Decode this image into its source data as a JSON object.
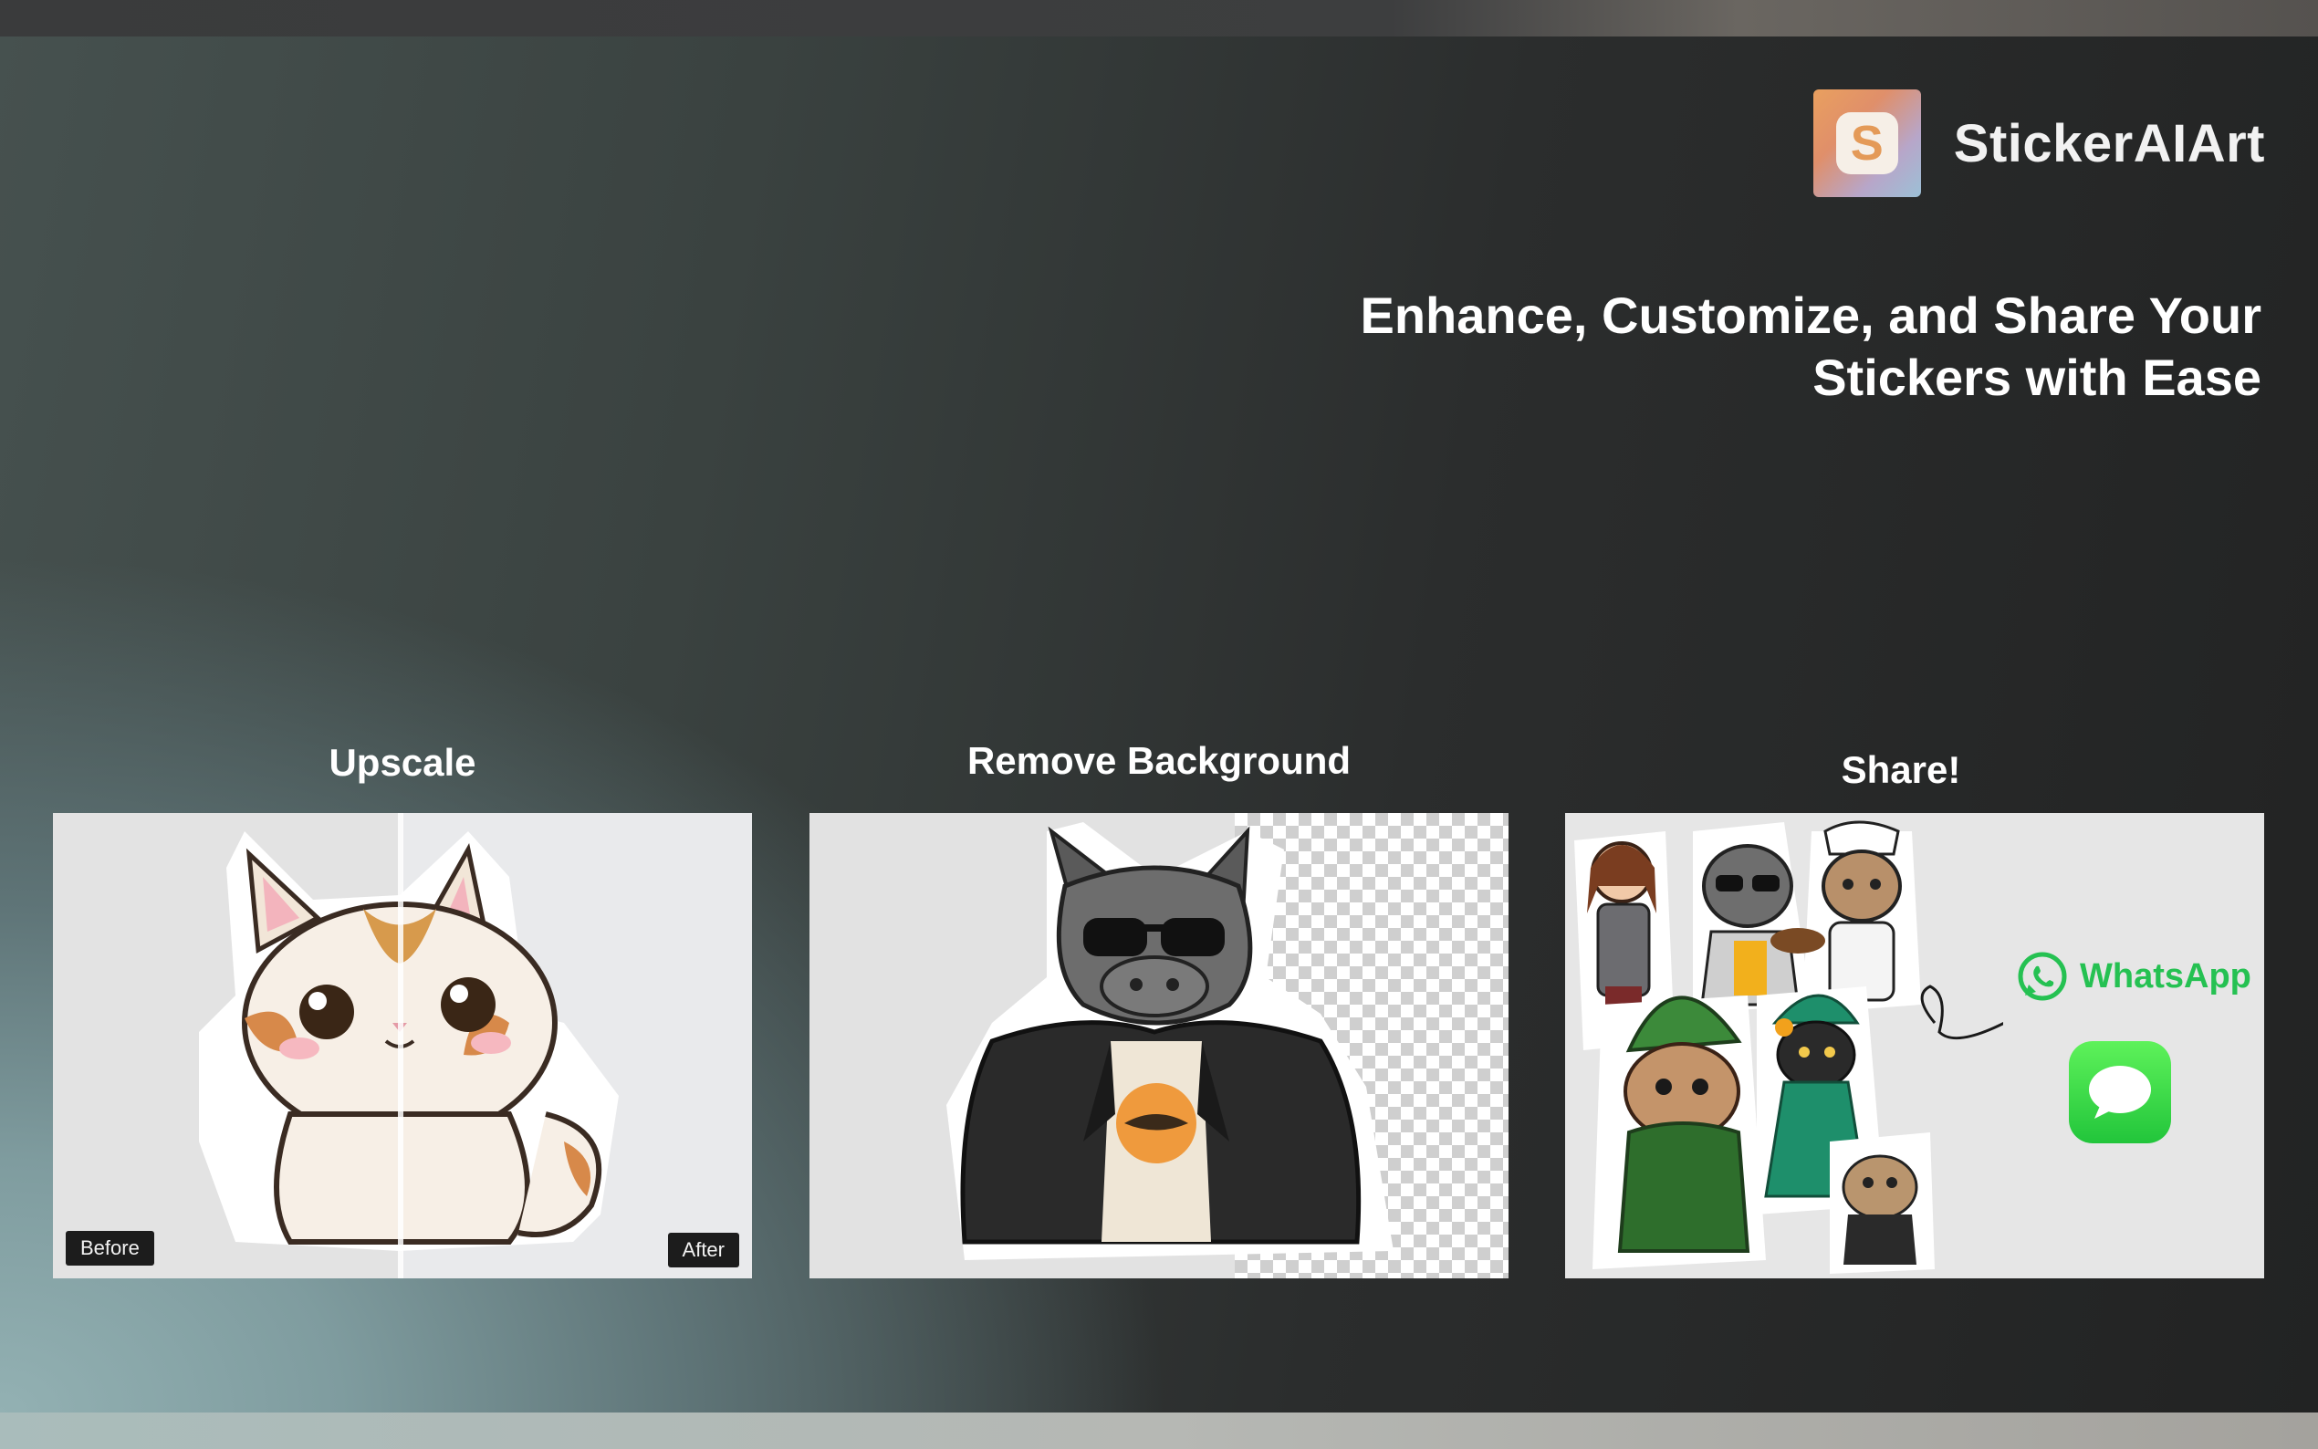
{
  "brand": {
    "name": "StickerAIArt",
    "icon_letter": "S",
    "icon": "sticker-app-icon"
  },
  "headline": {
    "line1": "Enhance, Customize, and Share Your",
    "line2": "Stickers with Ease"
  },
  "features": [
    {
      "title": "Upscale",
      "before_label": "Before",
      "after_label": "After",
      "image": "cat-sticker-before-after"
    },
    {
      "title": "Remove Background",
      "image": "rhino-sticker-leather-jacket"
    },
    {
      "title": "Share!",
      "image": "sticker-collection",
      "share_targets": [
        "WhatsApp",
        "Messages"
      ]
    }
  ],
  "share": {
    "whatsapp_label": "WhatsApp"
  },
  "colors": {
    "whatsapp_green": "#25c152",
    "messages_green": "#33d14a",
    "brand_orange": "#e49a58"
  }
}
